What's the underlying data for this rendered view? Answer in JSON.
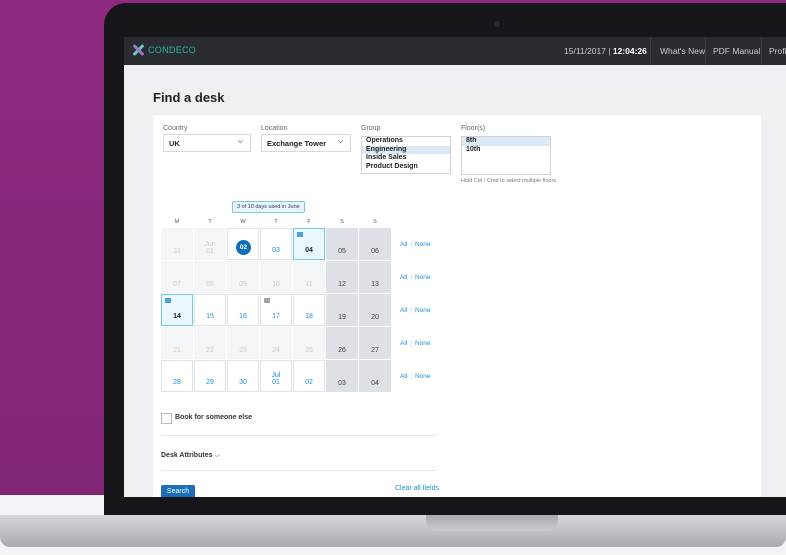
{
  "brand": {
    "name": "CONDECO",
    "accent": "#28b8a6"
  },
  "nav": {
    "date": "15/11/2017 | ",
    "time": "12:04:26",
    "items": [
      "What's New",
      "PDF Manual",
      "Profile"
    ]
  },
  "page": {
    "title": "Find a desk"
  },
  "filters": {
    "country": {
      "label": "Country",
      "value": "UK"
    },
    "location": {
      "label": "Location",
      "value": "Exchange Tower"
    },
    "group": {
      "label": "Group",
      "options": [
        "Operations",
        "Engineering",
        "Inside Sales",
        "Product Design"
      ],
      "selected": "Engineering"
    },
    "floors": {
      "label": "Floor(s)",
      "options": [
        "8th",
        "10th"
      ],
      "selected": "8th",
      "hint": "Hold Ctrl / Cmd to select multiple floors."
    }
  },
  "calendar": {
    "usage_badge": "3 of 10 days used in June",
    "day_headers": [
      "M",
      "T",
      "W",
      "T",
      "F",
      "S",
      "S"
    ],
    "weeks": [
      [
        {
          "t": "31",
          "s": "blank"
        },
        {
          "t": "Jun\n01",
          "s": "blank"
        },
        {
          "t": "02",
          "s": "today"
        },
        {
          "t": "03",
          "s": "av"
        },
        {
          "t": "04",
          "s": "booked",
          "icon": "blue"
        },
        {
          "t": "05",
          "s": "wk"
        },
        {
          "t": "06",
          "s": "wk"
        }
      ],
      [
        {
          "t": "07",
          "s": "blank"
        },
        {
          "t": "08",
          "s": "blank"
        },
        {
          "t": "09",
          "s": "blank"
        },
        {
          "t": "10",
          "s": "blank"
        },
        {
          "t": "11",
          "s": "blank"
        },
        {
          "t": "12",
          "s": "wk"
        },
        {
          "t": "13",
          "s": "wk"
        }
      ],
      [
        {
          "t": "14",
          "s": "booked",
          "icon": "blue"
        },
        {
          "t": "15",
          "s": "av"
        },
        {
          "t": "16",
          "s": "av"
        },
        {
          "t": "17",
          "s": "av",
          "icon": "grey"
        },
        {
          "t": "18",
          "s": "av"
        },
        {
          "t": "19",
          "s": "wk"
        },
        {
          "t": "20",
          "s": "wk"
        }
      ],
      [
        {
          "t": "21",
          "s": "blank"
        },
        {
          "t": "22",
          "s": "blank"
        },
        {
          "t": "23",
          "s": "blank"
        },
        {
          "t": "24",
          "s": "blank"
        },
        {
          "t": "25",
          "s": "blank"
        },
        {
          "t": "26",
          "s": "wk"
        },
        {
          "t": "27",
          "s": "wk"
        }
      ],
      [
        {
          "t": "28",
          "s": "av"
        },
        {
          "t": "29",
          "s": "av"
        },
        {
          "t": "30",
          "s": "av"
        },
        {
          "t": "Jul\n01",
          "s": "av"
        },
        {
          "t": "02",
          "s": "av"
        },
        {
          "t": "03",
          "s": "wk"
        },
        {
          "t": "04",
          "s": "wk"
        }
      ]
    ],
    "row_actions": {
      "all": "All",
      "none": "None"
    }
  },
  "book_for_someone_else": {
    "label": "Book for someone else"
  },
  "desk_attributes": {
    "label": "Desk Attributes",
    "chevron": "chevron-down-icon"
  },
  "actions": {
    "search": "Search",
    "clear": "Clear all fields"
  }
}
